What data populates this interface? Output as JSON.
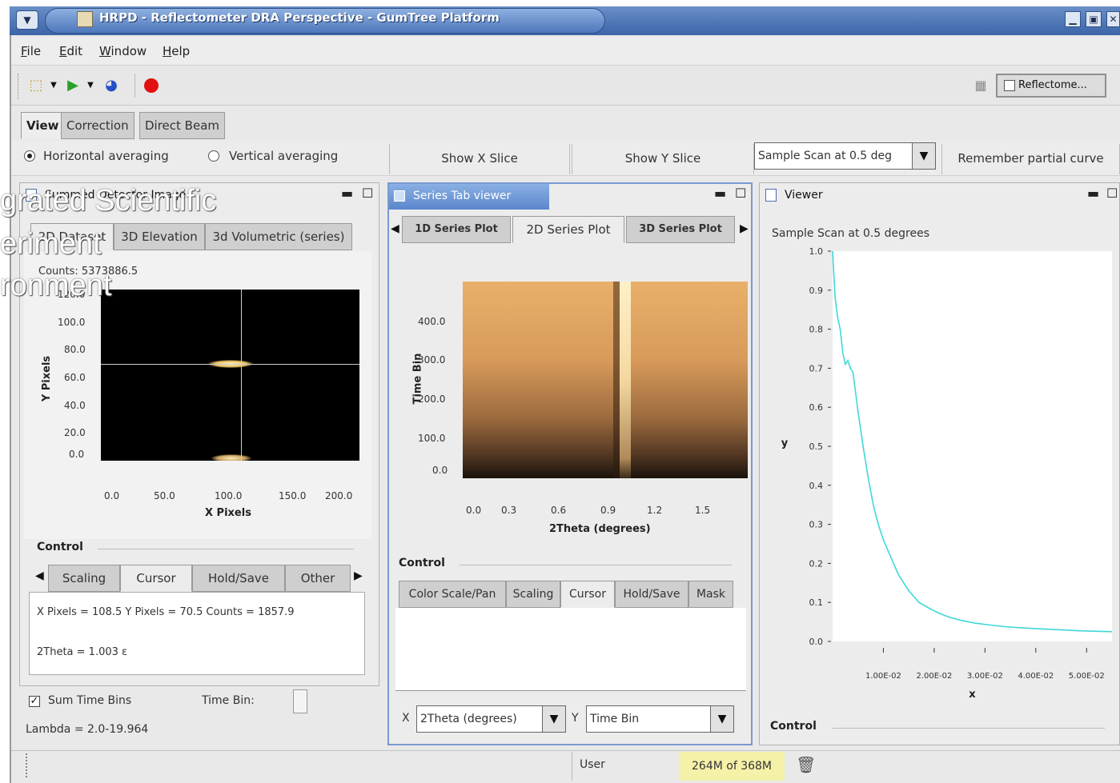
{
  "window": {
    "title": "HRPD - Reflectometer DRA Perspective - GumTree Platform",
    "controls": [
      "▁",
      "▣",
      "✕"
    ]
  },
  "menu": [
    "File",
    "Edit",
    "Window",
    "Help"
  ],
  "toolbar": {
    "perspective_label": "Reflectome..."
  },
  "main_tabs": [
    {
      "label": "View",
      "active": true
    },
    {
      "label": "Correction",
      "active": false
    },
    {
      "label": "Direct Beam",
      "active": false
    }
  ],
  "options": {
    "horizontal_averaging": "Horizontal averaging",
    "vertical_averaging": "Vertical averaging",
    "show_x_slice": "Show X Slice",
    "show_y_slice": "Show Y Slice",
    "scan_select": "Sample Scan at 0.5 deg",
    "remember_partial": "Remember partial curve"
  },
  "overlay": {
    "line1": "grated Scientific",
    "line2": "eriment",
    "line3": "ronment"
  },
  "left_panel": {
    "title": "Summed Detector Image",
    "tabs": [
      "2D Dataset",
      "3D Elevation",
      "3d Volumetric (series)"
    ],
    "counts": "Counts: 5373886.5",
    "y_axis_label": "Y Pixels",
    "x_axis_label": "X Pixels",
    "y_ticks": [
      "120.0",
      "100.0",
      "80.0",
      "60.0",
      "40.0",
      "20.0",
      "0.0"
    ],
    "x_ticks": [
      "0.0",
      "50.0",
      "100.0",
      "150.0",
      "200.0"
    ],
    "control_label": "Control",
    "control_tabs": [
      "Scaling",
      "Cursor",
      "Hold/Save",
      "Other"
    ],
    "cursor_line1": "X Pixels = 108.5  Y Pixels = 70.5    Counts = 1857.9",
    "cursor_line2": "2Theta = 1.003 ε",
    "sum_time_bins": "Sum Time Bins",
    "time_bin": "Time Bin:",
    "lambda": "Lambda = 2.0-19.964"
  },
  "center_panel": {
    "title": "Series Tab viewer",
    "tabs": [
      "1D Series Plot",
      "2D Series Plot",
      "3D Series Plot"
    ],
    "y_axis_label": "Time Bin",
    "x_axis_label": "2Theta (degrees)",
    "y_ticks": [
      "400.0",
      "300.0",
      "200.0",
      "100.0",
      "0.0"
    ],
    "x_ticks": [
      "0.0",
      "0.3",
      "0.6",
      "0.9",
      "1.2",
      "1.5"
    ],
    "control_label": "Control",
    "control_tabs": [
      "Color Scale/Pan",
      "Scaling",
      "Cursor",
      "Hold/Save",
      "Mask"
    ],
    "x_label": "X",
    "x_select": "2Theta (degrees)",
    "y_label": "Y",
    "y_select": "Time Bin"
  },
  "right_panel": {
    "title": "Viewer",
    "plot_title": "Sample Scan at 0.5 degrees",
    "control_label": "Control"
  },
  "status": {
    "user": "User",
    "memory": "264M of 368M"
  },
  "chart_data": {
    "type": "line",
    "title": "Sample Scan at 0.5 degrees",
    "xlabel": "x",
    "ylabel": "y",
    "xlim": [
      0.0,
      0.055
    ],
    "ylim": [
      0.0,
      1.0
    ],
    "x_ticks": [
      "1.00E-02",
      "2.00E-02",
      "3.00E-02",
      "4.00E-02",
      "5.00E-02"
    ],
    "y_ticks": [
      "1.0",
      "0.9",
      "0.8",
      "0.7",
      "0.6",
      "0.5",
      "0.4",
      "0.3",
      "0.2",
      "0.1",
      "0.0"
    ],
    "series": [
      {
        "color": "#3fd8d8",
        "x": [
          0.0,
          0.0005,
          0.001,
          0.0015,
          0.002,
          0.0025,
          0.003,
          0.0035,
          0.004,
          0.0045,
          0.005,
          0.006,
          0.007,
          0.008,
          0.009,
          0.01,
          0.011,
          0.012,
          0.013,
          0.014,
          0.015,
          0.017,
          0.019,
          0.021,
          0.023,
          0.025,
          0.028,
          0.031,
          0.034,
          0.037,
          0.04,
          0.043,
          0.046,
          0.049,
          0.052,
          0.055
        ],
        "y": [
          1.0,
          0.88,
          0.83,
          0.8,
          0.74,
          0.71,
          0.72,
          0.7,
          0.69,
          0.64,
          0.59,
          0.5,
          0.42,
          0.35,
          0.3,
          0.26,
          0.23,
          0.2,
          0.17,
          0.15,
          0.13,
          0.1,
          0.085,
          0.072,
          0.062,
          0.055,
          0.047,
          0.042,
          0.038,
          0.035,
          0.033,
          0.031,
          0.029,
          0.027,
          0.026,
          0.025
        ]
      }
    ],
    "grid": false,
    "legend": "none"
  }
}
